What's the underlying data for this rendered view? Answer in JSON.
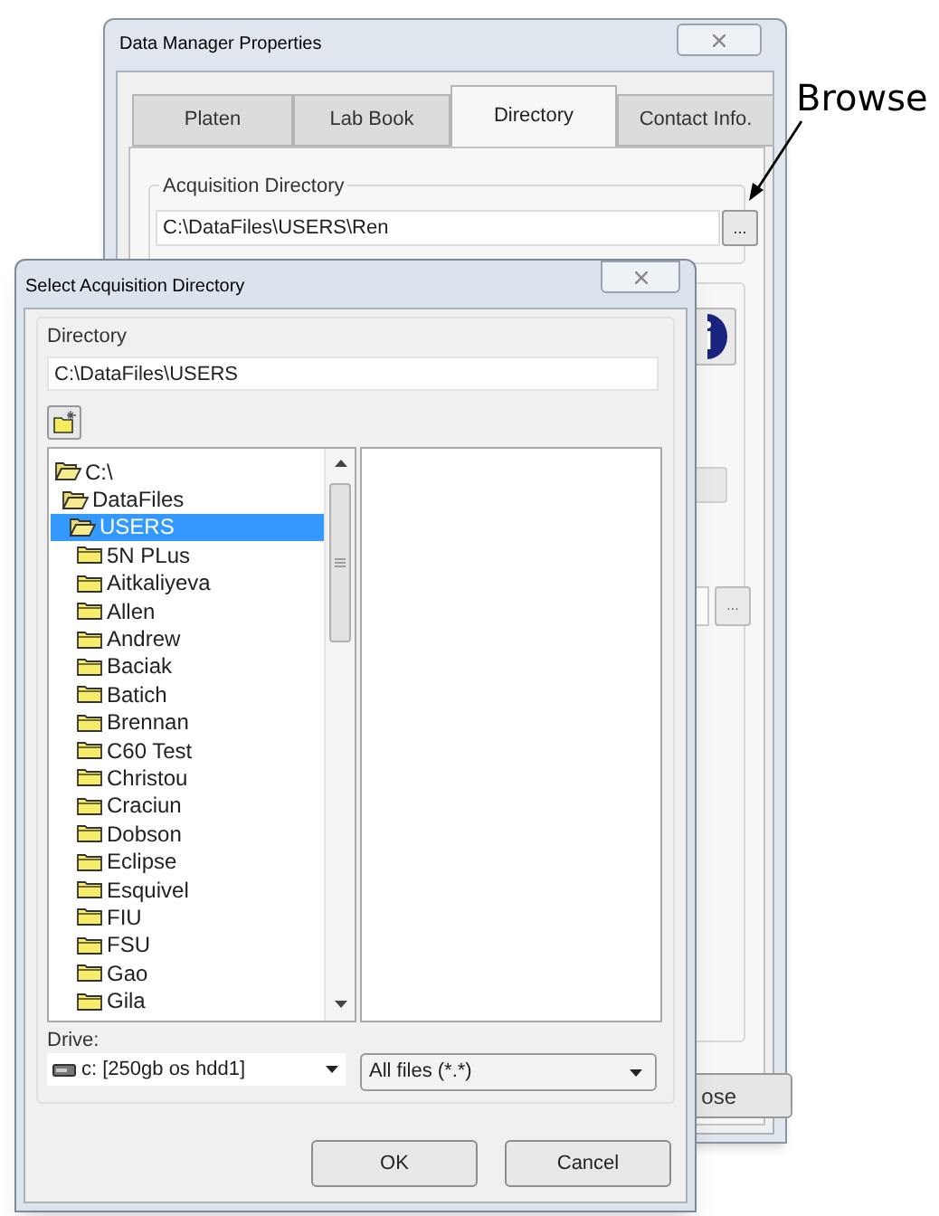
{
  "back_window": {
    "title": "Data Manager Properties",
    "tabs": [
      {
        "label": "Platen",
        "selected": false
      },
      {
        "label": "Lab Book",
        "selected": false
      },
      {
        "label": "Directory",
        "selected": true
      },
      {
        "label": "Contact Info.",
        "selected": false
      }
    ],
    "acquisition_group": {
      "label": "Acquisition Directory",
      "path_field": {
        "value": "C:\\DataFiles\\USERS\\Ren"
      },
      "browse_button": "..."
    },
    "second_browse_button": "...",
    "close_button": "ose"
  },
  "annotation": {
    "label": "Browse"
  },
  "dialog": {
    "title": "Select Acquisition Directory",
    "directory_group": {
      "label": "Directory",
      "path_field": {
        "value": "C:\\DataFiles\\USERS"
      }
    },
    "tree": [
      {
        "label": "C:\\",
        "expanded": true,
        "selected": false,
        "children": [
          {
            "label": "DataFiles",
            "expanded": true,
            "selected": false,
            "children": [
              {
                "label": "USERS",
                "expanded": true,
                "selected": true,
                "children": [
                  {
                    "label": "5N PLus",
                    "expanded": false,
                    "selected": false
                  },
                  {
                    "label": "Aitkaliyeva",
                    "expanded": false,
                    "selected": false
                  },
                  {
                    "label": "Allen",
                    "expanded": false,
                    "selected": false
                  },
                  {
                    "label": "Andrew",
                    "expanded": false,
                    "selected": false
                  },
                  {
                    "label": "Baciak",
                    "expanded": false,
                    "selected": false
                  },
                  {
                    "label": "Batich",
                    "expanded": false,
                    "selected": false
                  },
                  {
                    "label": "Brennan",
                    "expanded": false,
                    "selected": false
                  },
                  {
                    "label": "C60 Test",
                    "expanded": false,
                    "selected": false
                  },
                  {
                    "label": "Christou",
                    "expanded": false,
                    "selected": false
                  },
                  {
                    "label": "Craciun",
                    "expanded": false,
                    "selected": false
                  },
                  {
                    "label": "Dobson",
                    "expanded": false,
                    "selected": false
                  },
                  {
                    "label": "Eclipse",
                    "expanded": false,
                    "selected": false
                  },
                  {
                    "label": "Esquivel",
                    "expanded": false,
                    "selected": false
                  },
                  {
                    "label": "FIU",
                    "expanded": false,
                    "selected": false
                  },
                  {
                    "label": "FSU",
                    "expanded": false,
                    "selected": false
                  },
                  {
                    "label": "Gao",
                    "expanded": false,
                    "selected": false
                  },
                  {
                    "label": "Gila",
                    "expanded": false,
                    "selected": false
                  }
                ]
              }
            ]
          }
        ]
      }
    ],
    "drive": {
      "label": "Drive:",
      "value": "c: [250gb os hdd1]"
    },
    "filter": {
      "value": "All files (*.*)"
    },
    "buttons": [
      {
        "label": "OK"
      },
      {
        "label": "Cancel"
      }
    ]
  }
}
